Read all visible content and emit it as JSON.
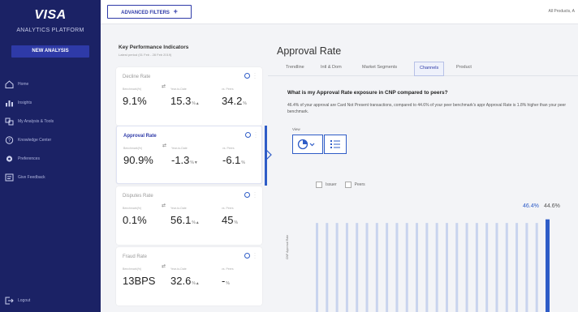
{
  "sidebar": {
    "brand": "VISA",
    "platform": "ANALYTICS PLATFORM",
    "new_analysis": "NEW ANALYSIS",
    "items": [
      {
        "label": "Home",
        "icon": "home-icon"
      },
      {
        "label": "Insights",
        "icon": "chart-icon"
      },
      {
        "label": "My Analysis & Tools",
        "icon": "tools-icon"
      },
      {
        "label": "Knowledge Center",
        "icon": "help-icon"
      },
      {
        "label": "Preferences",
        "icon": "gear-icon"
      },
      {
        "label": "Give Feedback",
        "icon": "feedback-icon"
      }
    ],
    "logout": "Logout"
  },
  "topbar": {
    "advanced_filters": "ADVANCED FILTERS",
    "right_text": "All Products, A"
  },
  "kpi": {
    "title": "Key Performance Indicators",
    "subtitle": "Latest period (01 Feb - 28 Feb 2019)",
    "columns": {
      "c1": "Benchmark(%)",
      "c2": "Year-to-Date",
      "c3": "vs. Peers"
    },
    "cards": [
      {
        "title": "Decline Rate",
        "v1": "9.1%",
        "v2": "15.3",
        "v2s": "%▲",
        "v3": "34.2",
        "v3s": "%"
      },
      {
        "title": "Approval Rate",
        "v1": "90.9%",
        "v2": "-1.3",
        "v2s": "%▼",
        "v3": "-6.1",
        "v3s": "%"
      },
      {
        "title": "Disputes Rate",
        "v1": "0.1%",
        "v2": "56.1",
        "v2s": "%▲",
        "v3": "45",
        "v3s": "%"
      },
      {
        "title": "Fraud Rate",
        "v1": "13BPS",
        "v2": "32.6",
        "v2s": "%▲",
        "v3": "-",
        "v3s": "%"
      }
    ]
  },
  "main": {
    "title": "Approval Rate",
    "tabs": [
      "Trendline",
      "Intl & Dom",
      "Market Segments",
      "Channels",
      "Product"
    ],
    "active_tab": "Channels",
    "question": "What is my Approval Rate exposure in CNP compared to peers?",
    "description": "46.4% of your approval are Card Not Present transactions, compared to 44.6% of your peer benchmark's appr Approval Rate is 1.8% higher than your peer benchmark.",
    "view_label": "View",
    "legend": [
      "Issuer",
      "Peers"
    ],
    "y_axis_label": "CNP Approval Rate"
  },
  "chart_data": {
    "type": "bar",
    "data_labels": [
      "46.4%",
      "44.6%"
    ],
    "issuer_value": 46.4,
    "peer_value": 44.6,
    "series": [
      {
        "name": "Issuer",
        "color": "#2e5cc7"
      },
      {
        "name": "Peers",
        "color": "#c9d4ee"
      }
    ],
    "bar_count": 24
  }
}
